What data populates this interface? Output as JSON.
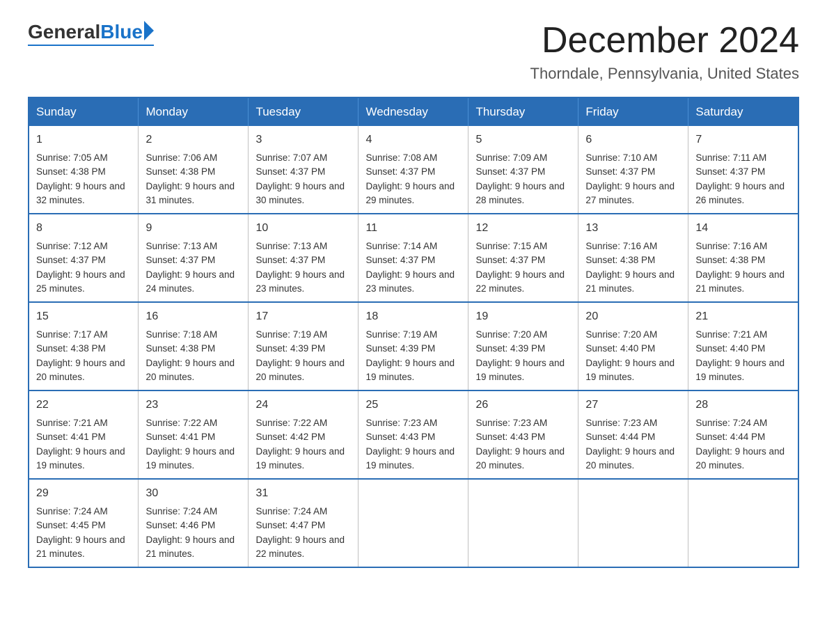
{
  "logo": {
    "general": "General",
    "blue": "Blue"
  },
  "title": {
    "month_year": "December 2024",
    "location": "Thorndale, Pennsylvania, United States"
  },
  "weekdays": [
    "Sunday",
    "Monday",
    "Tuesday",
    "Wednesday",
    "Thursday",
    "Friday",
    "Saturday"
  ],
  "weeks": [
    [
      {
        "day": "1",
        "sunrise": "Sunrise: 7:05 AM",
        "sunset": "Sunset: 4:38 PM",
        "daylight": "Daylight: 9 hours and 32 minutes."
      },
      {
        "day": "2",
        "sunrise": "Sunrise: 7:06 AM",
        "sunset": "Sunset: 4:38 PM",
        "daylight": "Daylight: 9 hours and 31 minutes."
      },
      {
        "day": "3",
        "sunrise": "Sunrise: 7:07 AM",
        "sunset": "Sunset: 4:37 PM",
        "daylight": "Daylight: 9 hours and 30 minutes."
      },
      {
        "day": "4",
        "sunrise": "Sunrise: 7:08 AM",
        "sunset": "Sunset: 4:37 PM",
        "daylight": "Daylight: 9 hours and 29 minutes."
      },
      {
        "day": "5",
        "sunrise": "Sunrise: 7:09 AM",
        "sunset": "Sunset: 4:37 PM",
        "daylight": "Daylight: 9 hours and 28 minutes."
      },
      {
        "day": "6",
        "sunrise": "Sunrise: 7:10 AM",
        "sunset": "Sunset: 4:37 PM",
        "daylight": "Daylight: 9 hours and 27 minutes."
      },
      {
        "day": "7",
        "sunrise": "Sunrise: 7:11 AM",
        "sunset": "Sunset: 4:37 PM",
        "daylight": "Daylight: 9 hours and 26 minutes."
      }
    ],
    [
      {
        "day": "8",
        "sunrise": "Sunrise: 7:12 AM",
        "sunset": "Sunset: 4:37 PM",
        "daylight": "Daylight: 9 hours and 25 minutes."
      },
      {
        "day": "9",
        "sunrise": "Sunrise: 7:13 AM",
        "sunset": "Sunset: 4:37 PM",
        "daylight": "Daylight: 9 hours and 24 minutes."
      },
      {
        "day": "10",
        "sunrise": "Sunrise: 7:13 AM",
        "sunset": "Sunset: 4:37 PM",
        "daylight": "Daylight: 9 hours and 23 minutes."
      },
      {
        "day": "11",
        "sunrise": "Sunrise: 7:14 AM",
        "sunset": "Sunset: 4:37 PM",
        "daylight": "Daylight: 9 hours and 23 minutes."
      },
      {
        "day": "12",
        "sunrise": "Sunrise: 7:15 AM",
        "sunset": "Sunset: 4:37 PM",
        "daylight": "Daylight: 9 hours and 22 minutes."
      },
      {
        "day": "13",
        "sunrise": "Sunrise: 7:16 AM",
        "sunset": "Sunset: 4:38 PM",
        "daylight": "Daylight: 9 hours and 21 minutes."
      },
      {
        "day": "14",
        "sunrise": "Sunrise: 7:16 AM",
        "sunset": "Sunset: 4:38 PM",
        "daylight": "Daylight: 9 hours and 21 minutes."
      }
    ],
    [
      {
        "day": "15",
        "sunrise": "Sunrise: 7:17 AM",
        "sunset": "Sunset: 4:38 PM",
        "daylight": "Daylight: 9 hours and 20 minutes."
      },
      {
        "day": "16",
        "sunrise": "Sunrise: 7:18 AM",
        "sunset": "Sunset: 4:38 PM",
        "daylight": "Daylight: 9 hours and 20 minutes."
      },
      {
        "day": "17",
        "sunrise": "Sunrise: 7:19 AM",
        "sunset": "Sunset: 4:39 PM",
        "daylight": "Daylight: 9 hours and 20 minutes."
      },
      {
        "day": "18",
        "sunrise": "Sunrise: 7:19 AM",
        "sunset": "Sunset: 4:39 PM",
        "daylight": "Daylight: 9 hours and 19 minutes."
      },
      {
        "day": "19",
        "sunrise": "Sunrise: 7:20 AM",
        "sunset": "Sunset: 4:39 PM",
        "daylight": "Daylight: 9 hours and 19 minutes."
      },
      {
        "day": "20",
        "sunrise": "Sunrise: 7:20 AM",
        "sunset": "Sunset: 4:40 PM",
        "daylight": "Daylight: 9 hours and 19 minutes."
      },
      {
        "day": "21",
        "sunrise": "Sunrise: 7:21 AM",
        "sunset": "Sunset: 4:40 PM",
        "daylight": "Daylight: 9 hours and 19 minutes."
      }
    ],
    [
      {
        "day": "22",
        "sunrise": "Sunrise: 7:21 AM",
        "sunset": "Sunset: 4:41 PM",
        "daylight": "Daylight: 9 hours and 19 minutes."
      },
      {
        "day": "23",
        "sunrise": "Sunrise: 7:22 AM",
        "sunset": "Sunset: 4:41 PM",
        "daylight": "Daylight: 9 hours and 19 minutes."
      },
      {
        "day": "24",
        "sunrise": "Sunrise: 7:22 AM",
        "sunset": "Sunset: 4:42 PM",
        "daylight": "Daylight: 9 hours and 19 minutes."
      },
      {
        "day": "25",
        "sunrise": "Sunrise: 7:23 AM",
        "sunset": "Sunset: 4:43 PM",
        "daylight": "Daylight: 9 hours and 19 minutes."
      },
      {
        "day": "26",
        "sunrise": "Sunrise: 7:23 AM",
        "sunset": "Sunset: 4:43 PM",
        "daylight": "Daylight: 9 hours and 20 minutes."
      },
      {
        "day": "27",
        "sunrise": "Sunrise: 7:23 AM",
        "sunset": "Sunset: 4:44 PM",
        "daylight": "Daylight: 9 hours and 20 minutes."
      },
      {
        "day": "28",
        "sunrise": "Sunrise: 7:24 AM",
        "sunset": "Sunset: 4:44 PM",
        "daylight": "Daylight: 9 hours and 20 minutes."
      }
    ],
    [
      {
        "day": "29",
        "sunrise": "Sunrise: 7:24 AM",
        "sunset": "Sunset: 4:45 PM",
        "daylight": "Daylight: 9 hours and 21 minutes."
      },
      {
        "day": "30",
        "sunrise": "Sunrise: 7:24 AM",
        "sunset": "Sunset: 4:46 PM",
        "daylight": "Daylight: 9 hours and 21 minutes."
      },
      {
        "day": "31",
        "sunrise": "Sunrise: 7:24 AM",
        "sunset": "Sunset: 4:47 PM",
        "daylight": "Daylight: 9 hours and 22 minutes."
      },
      null,
      null,
      null,
      null
    ]
  ]
}
